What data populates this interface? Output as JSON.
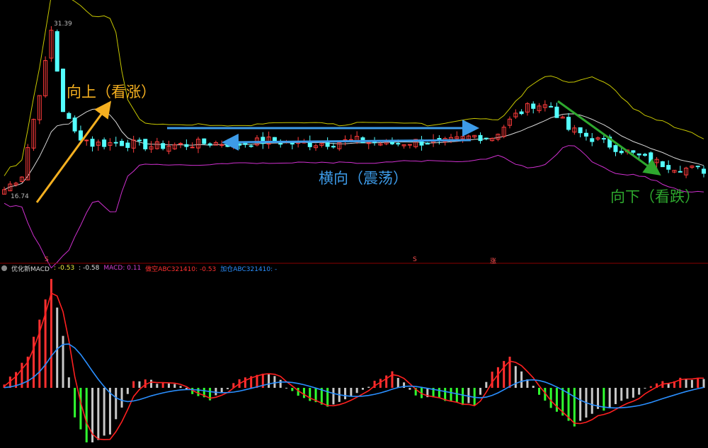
{
  "annotations": {
    "up": "向上（看涨）",
    "side": "横向（震荡）",
    "down": "向下（看跌）"
  },
  "price_labels": {
    "high": "31.39",
    "low": "16.74"
  },
  "markers": {
    "s1": "S",
    "s2": "S",
    "zhang": "涨"
  },
  "macd_header": {
    "name": "优化新MACD",
    "v1": ": -0.53",
    "v2": ": -0.58",
    "macd": "MACD: 0.11",
    "sell": "做空ABC321410: -0.53",
    "buy": "加仓ABC321410: -"
  },
  "colors": {
    "up_candle": "#ff3c3c",
    "down_candle": "#54ffff",
    "upper_band": "#c8c800",
    "mid_band": "#d8d8d8",
    "lower_band": "#d030d0",
    "arrow_up": "#f5b020",
    "arrow_side": "#3d9be8",
    "arrow_down": "#2ea82e",
    "macd_pos": "#ff3030",
    "macd_pos_fade": "#c8c8c8",
    "macd_neg": "#30ff30",
    "macd_neg_fade": "#c8c8c8",
    "dif_line": "#ff2020",
    "dea_line": "#2a8fff"
  },
  "chart_data": {
    "type": "candlestick",
    "count": 120,
    "price_points": [
      [
        0,
        17.5
      ],
      [
        3,
        18.8
      ],
      [
        7,
        28.5
      ],
      [
        8,
        31.39
      ],
      [
        10,
        24.5
      ],
      [
        12,
        22.5
      ],
      [
        15,
        21.5
      ],
      [
        20,
        21.6
      ],
      [
        25,
        21.3
      ],
      [
        30,
        21.4
      ],
      [
        35,
        21.6
      ],
      [
        40,
        21.5
      ],
      [
        45,
        21.8
      ],
      [
        50,
        21.5
      ],
      [
        55,
        21.6
      ],
      [
        60,
        21.8
      ],
      [
        65,
        21.5
      ],
      [
        70,
        21.7
      ],
      [
        75,
        21.6
      ],
      [
        80,
        22.2
      ],
      [
        83,
        22.1
      ],
      [
        87,
        24.0
      ],
      [
        90,
        25.0
      ],
      [
        93,
        24.8
      ],
      [
        96,
        22.8
      ],
      [
        100,
        22.0
      ],
      [
        105,
        21.0
      ],
      [
        110,
        20.0
      ],
      [
        115,
        19.4
      ],
      [
        119,
        19.2
      ]
    ],
    "low_label_value": 16.74,
    "macd_points": [
      [
        0,
        0.1
      ],
      [
        4,
        1.2
      ],
      [
        8,
        4.3
      ],
      [
        10,
        2.0
      ],
      [
        12,
        -1.2
      ],
      [
        14,
        -2.2
      ],
      [
        18,
        -1.8
      ],
      [
        22,
        0.3
      ],
      [
        28,
        0.2
      ],
      [
        35,
        -0.5
      ],
      [
        40,
        0.3
      ],
      [
        45,
        0.6
      ],
      [
        50,
        -0.3
      ],
      [
        55,
        -0.7
      ],
      [
        60,
        -0.2
      ],
      [
        66,
        0.7
      ],
      [
        70,
        -0.3
      ],
      [
        75,
        -0.5
      ],
      [
        80,
        -0.7
      ],
      [
        83,
        0.7
      ],
      [
        86,
        1.2
      ],
      [
        89,
        0.3
      ],
      [
        93,
        -0.8
      ],
      [
        97,
        -1.5
      ],
      [
        101,
        -0.9
      ],
      [
        106,
        -0.5
      ],
      [
        110,
        0.1
      ],
      [
        116,
        0.4
      ],
      [
        119,
        0.3
      ]
    ]
  }
}
